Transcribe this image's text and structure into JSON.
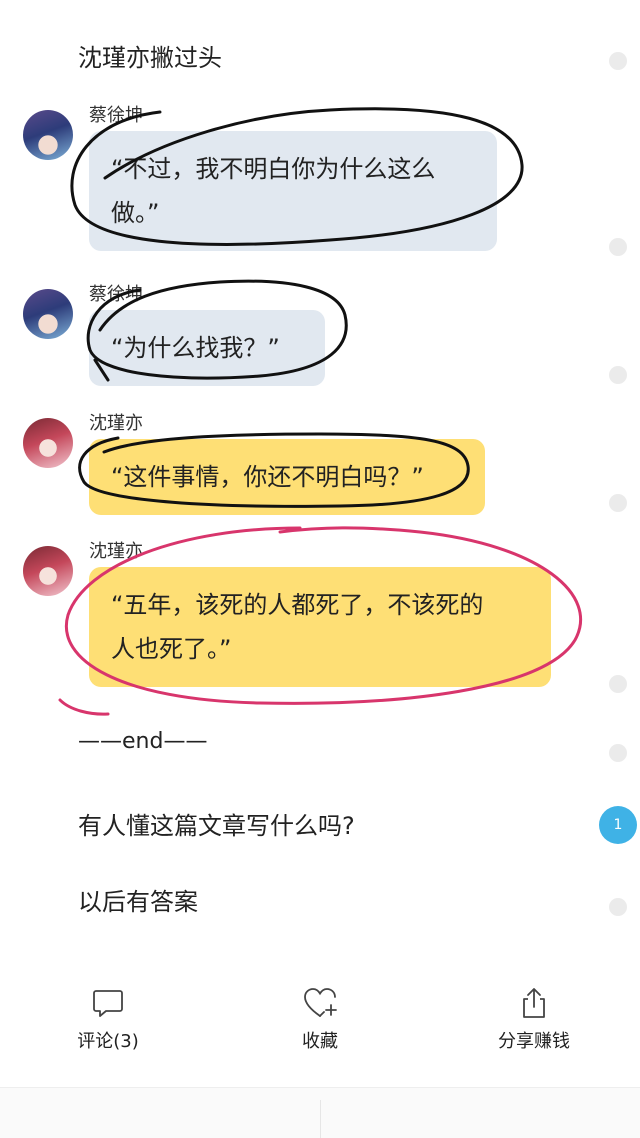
{
  "article": {
    "intro_line": "沈瑾亦撇过头",
    "end_marker": "——end——",
    "question_line": "有人懂这篇文章写什么吗?",
    "answer_line": "以后有答案"
  },
  "chat": [
    {
      "sender": "蔡徐坤",
      "avatar": "boy-avatar",
      "bubble_color": "#e1e8f0",
      "lines": [
        "“不过，我不明白你为什么这么",
        "做。”"
      ]
    },
    {
      "sender": "蔡徐坤",
      "avatar": "boy-avatar",
      "bubble_color": "#e1e8f0",
      "lines": [
        "“为什么找我？”"
      ]
    },
    {
      "sender": "沈瑾亦",
      "avatar": "girl-avatar",
      "bubble_color": "#fedf75",
      "lines": [
        "“这件事情，你还不明白吗？”"
      ]
    },
    {
      "sender": "沈瑾亦",
      "avatar": "girl-avatar",
      "bubble_color": "#fedf75",
      "lines": [
        "“五年，该死的人都死了，不该死的",
        "人也死了。”"
      ]
    }
  ],
  "side_badge": {
    "count": "1",
    "color": "#3fb2e6"
  },
  "actions": {
    "comment": {
      "label": "评论(3)",
      "icon": "comment-icon"
    },
    "favorite": {
      "label": "收藏",
      "icon": "heart-plus-icon"
    },
    "share": {
      "label": "分享赚钱",
      "icon": "share-icon"
    }
  },
  "annotation_colors": {
    "black_circle": "#111111",
    "pink_circle": "#d8356c"
  }
}
